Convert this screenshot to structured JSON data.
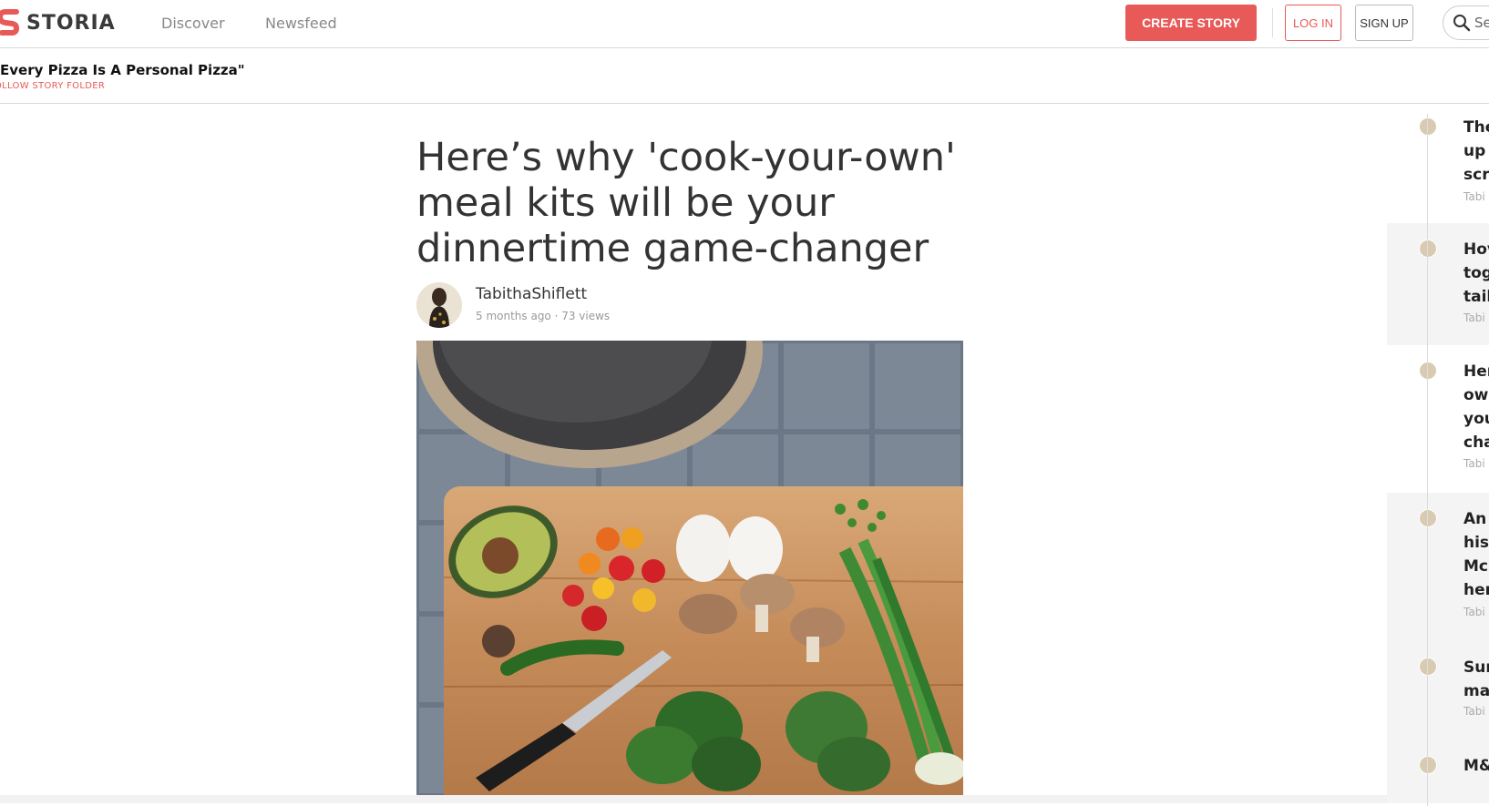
{
  "brand": {
    "name": "STORIA",
    "accent": "#e85a57"
  },
  "nav": {
    "discover": "Discover",
    "newsfeed": "Newsfeed"
  },
  "actions": {
    "create": "CREATE STORY",
    "login": "LOG IN",
    "signup": "SIGN UP"
  },
  "search": {
    "value": "Se"
  },
  "folder": {
    "title": "Every Pizza Is A Personal Pizza\"",
    "follow": "OLLOW STORY FOLDER"
  },
  "article": {
    "title": "Here’s why 'cook-your-own' meal kits will be your dinnertime game-changer",
    "author": "TabithaShiflett",
    "meta": "5 months ago · 73 views",
    "image": "cutting-board-with-vegetables-eggs-and-pan"
  },
  "rail": {
    "items": [
      {
        "text": "The\nup \nscra",
        "author": "Tabi"
      },
      {
        "text": "Hov\ntog\ntail",
        "author": "Tabi"
      },
      {
        "text": "Her\now\nyou\ncha",
        "author": "Tabi"
      },
      {
        "text": "An \nhis \nMcl\nher",
        "author": "Tabi"
      },
      {
        "text": "Sur\nma",
        "author": "Tabi"
      },
      {
        "text": "M&",
        "author": ""
      }
    ]
  }
}
